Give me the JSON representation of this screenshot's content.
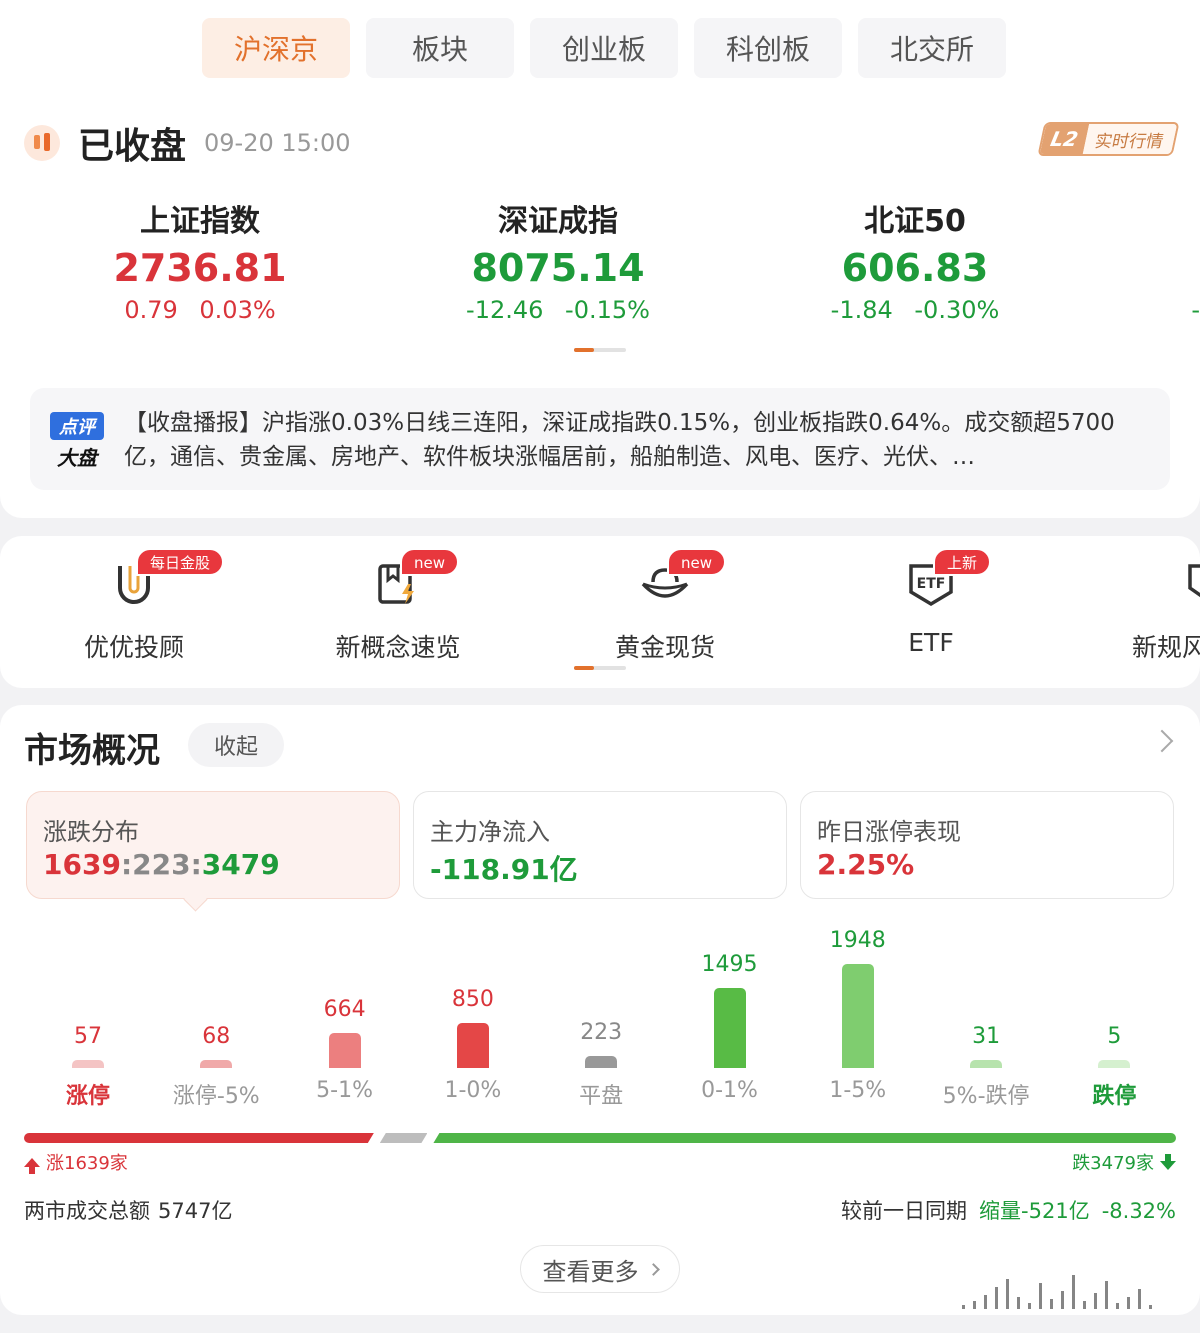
{
  "tabs": [
    "沪深京",
    "板块",
    "创业板",
    "科创板",
    "北交所"
  ],
  "active_tab": 0,
  "status": {
    "title": "已收盘",
    "time": "09-20 15:00",
    "badge_l2": "L2",
    "badge_text": "实时行情"
  },
  "indices": [
    {
      "name": "上证指数",
      "value": "2736.81",
      "change": "0.79 0.03%",
      "trend": "up"
    },
    {
      "name": "深证成指",
      "value": "8075.14",
      "change": "-12.46 -0.15%",
      "trend": "down"
    },
    {
      "name": "北证50",
      "value": "606.83",
      "change": "-1.84 -0.30%",
      "trend": "down"
    }
  ],
  "edge_dash": "-",
  "news": {
    "icon_line1": "点评",
    "icon_line2": "大盘",
    "text": "【收盘播报】沪指涨0.03%日线三连阳，深证成指跌0.15%，创业板指跌0.64%。成交额超5700亿，通信、贵金属、房地产、软件板块涨幅居前，船舶制造、风电、医疗、光伏、…"
  },
  "shortcuts": [
    {
      "label": "优优投顾",
      "badge": "每日金股",
      "icon": "magnet-icon"
    },
    {
      "label": "新概念速览",
      "badge": "new",
      "icon": "book-lightning-icon"
    },
    {
      "label": "黄金现货",
      "badge": "new",
      "icon": "gold-ingot-icon"
    },
    {
      "label": "ETF",
      "badge": "上新",
      "icon": "etf-shield-icon"
    },
    {
      "label": "新规风",
      "badge": "",
      "icon": "shield-lightning-icon"
    }
  ],
  "market": {
    "title": "市场概况",
    "collapse_label": "收起",
    "stats": [
      {
        "label": "涨跌分布",
        "up": "1639",
        "flat": "223",
        "down": "3479",
        "sep": ":"
      },
      {
        "label": "主力净流入",
        "value": "-118.91亿"
      },
      {
        "label": "昨日涨停表现",
        "value": "2.25%"
      }
    ],
    "up_label": "涨1639家",
    "down_label": "跌3479家",
    "turnover_label": "两市成交总额",
    "turnover_value": "5747亿",
    "compare_label": "较前一日同期",
    "compare_change": "缩量-521亿",
    "compare_pct": "-8.32%",
    "more_label": "查看更多"
  },
  "colors": {
    "accent": "#e2712c",
    "up": "#d9343a",
    "down": "#1e9b3a",
    "flat": "#999999"
  },
  "chart_data": {
    "type": "bar",
    "categories": [
      "涨停",
      "涨停-5%",
      "5-1%",
      "1-0%",
      "平盘",
      "0-1%",
      "1-5%",
      "5%-跌停",
      "跌停"
    ],
    "values": [
      57,
      68,
      664,
      850,
      223,
      1495,
      1948,
      31,
      5
    ],
    "bar_colors": [
      "#f4c4c4",
      "#f0a9a9",
      "#ec7f7f",
      "#e44747",
      "#999999",
      "#58bb45",
      "#7fcd6f",
      "#b7e3ad",
      "#d5f0cf"
    ],
    "label_colors": [
      "#d9343a",
      "#d9343a",
      "#d9343a",
      "#d9343a",
      "#888888",
      "#1e9b3a",
      "#1e9b3a",
      "#1e9b3a",
      "#1e9b3a"
    ],
    "cat_colors": [
      "#d9343a",
      "#999999",
      "#999999",
      "#999999",
      "#999999",
      "#999999",
      "#999999",
      "#999999",
      "#1e9b3a"
    ],
    "ylim": [
      0,
      1948
    ]
  }
}
